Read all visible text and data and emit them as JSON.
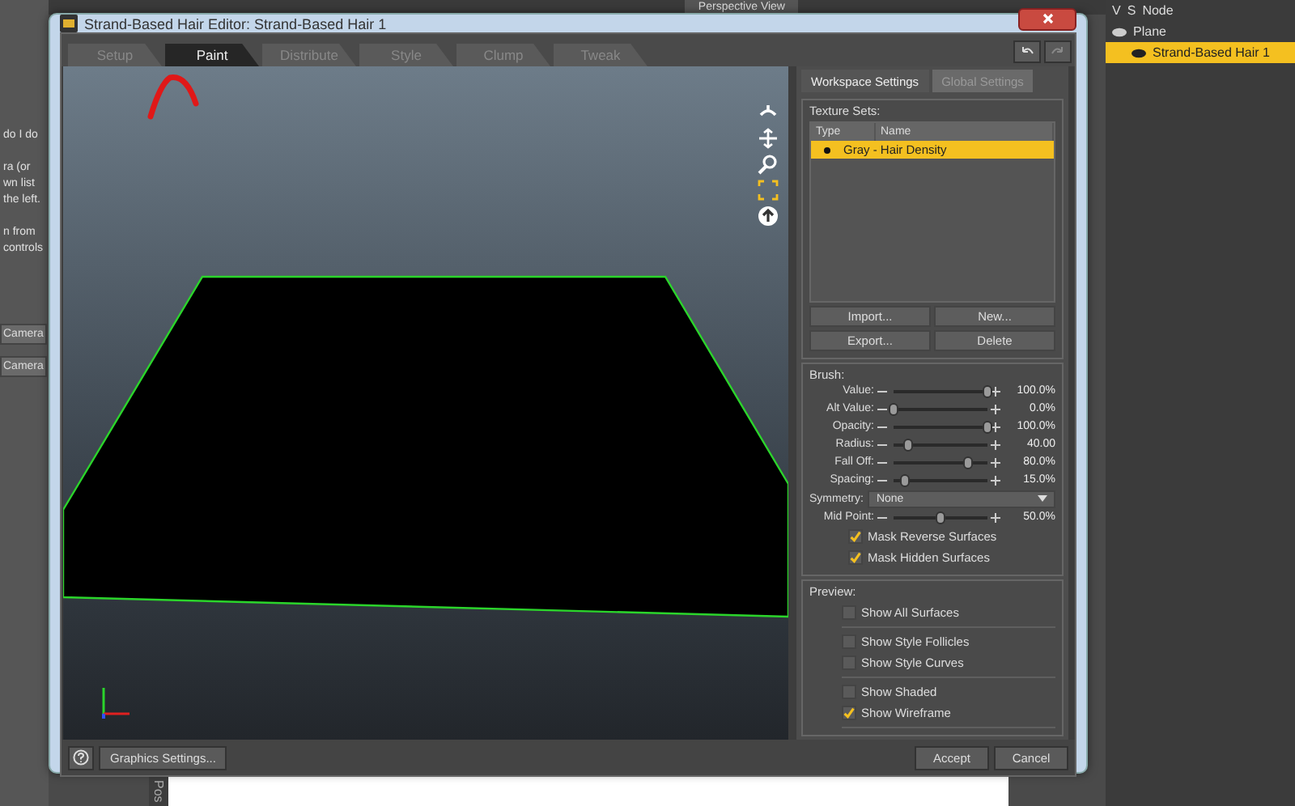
{
  "background_app": {
    "left_panel_texts": [
      "do I do",
      "ra (or",
      "wn list",
      "the left.",
      "n from",
      "controls"
    ],
    "left_buttons": [
      "Camera",
      "Camera"
    ],
    "viewport_title": "Perspective View",
    "scene_header": [
      "V",
      "S",
      "Node"
    ],
    "scene_items": [
      {
        "label": "Plane",
        "selected": false
      },
      {
        "label": "Strand-Based Hair 1",
        "selected": true
      }
    ],
    "side_tab": "Pos"
  },
  "window": {
    "title": "Strand-Based Hair Editor: Strand-Based Hair 1"
  },
  "tabs": [
    {
      "label": "Setup",
      "selected": false
    },
    {
      "label": "Paint",
      "selected": true
    },
    {
      "label": "Distribute",
      "selected": false
    },
    {
      "label": "Style",
      "selected": false
    },
    {
      "label": "Clump",
      "selected": false
    },
    {
      "label": "Tweak",
      "selected": false
    }
  ],
  "settings_tabs": [
    {
      "label": "Workspace Settings",
      "selected": true
    },
    {
      "label": "Global Settings",
      "selected": false
    }
  ],
  "texture_sets": {
    "title": "Texture Sets:",
    "columns": [
      "Type",
      "Name"
    ],
    "rows": [
      {
        "name": "Gray - Hair Density",
        "selected": true
      }
    ],
    "buttons": [
      "Import...",
      "New...",
      "Export...",
      "Delete"
    ]
  },
  "brush": {
    "title": "Brush:",
    "sliders": [
      {
        "label": "Value:",
        "level": 1.0,
        "reading": "100.0%"
      },
      {
        "label": "Alt Value:",
        "level": 0.0,
        "reading": "0.0%"
      },
      {
        "label": "Opacity:",
        "level": 1.0,
        "reading": "100.0%"
      },
      {
        "label": "Radius:",
        "level": 0.15,
        "reading": "40.00"
      },
      {
        "label": "Fall Off:",
        "level": 0.8,
        "reading": "80.0%"
      },
      {
        "label": "Spacing:",
        "level": 0.12,
        "reading": "15.0%"
      }
    ],
    "symmetry": {
      "label": "Symmetry:",
      "value": "None"
    },
    "mid_point": {
      "label": "Mid Point:",
      "level": 0.5,
      "reading": "50.0%"
    },
    "options": [
      {
        "label": "Mask Reverse Surfaces",
        "checked": true
      },
      {
        "label": "Mask Hidden Surfaces",
        "checked": true
      }
    ]
  },
  "preview": {
    "title": "Preview:",
    "groups": [
      [
        {
          "label": "Show All Surfaces",
          "checked": false
        }
      ],
      [
        {
          "label": "Show Style Follicles",
          "checked": false
        },
        {
          "label": "Show Style Curves",
          "checked": false
        }
      ],
      [
        {
          "label": "Show Shaded",
          "checked": false
        },
        {
          "label": "Show Wireframe",
          "checked": true
        }
      ]
    ]
  },
  "footer": {
    "left_button": "Graphics Settings...",
    "buttons": [
      "Accept",
      "Cancel"
    ]
  }
}
